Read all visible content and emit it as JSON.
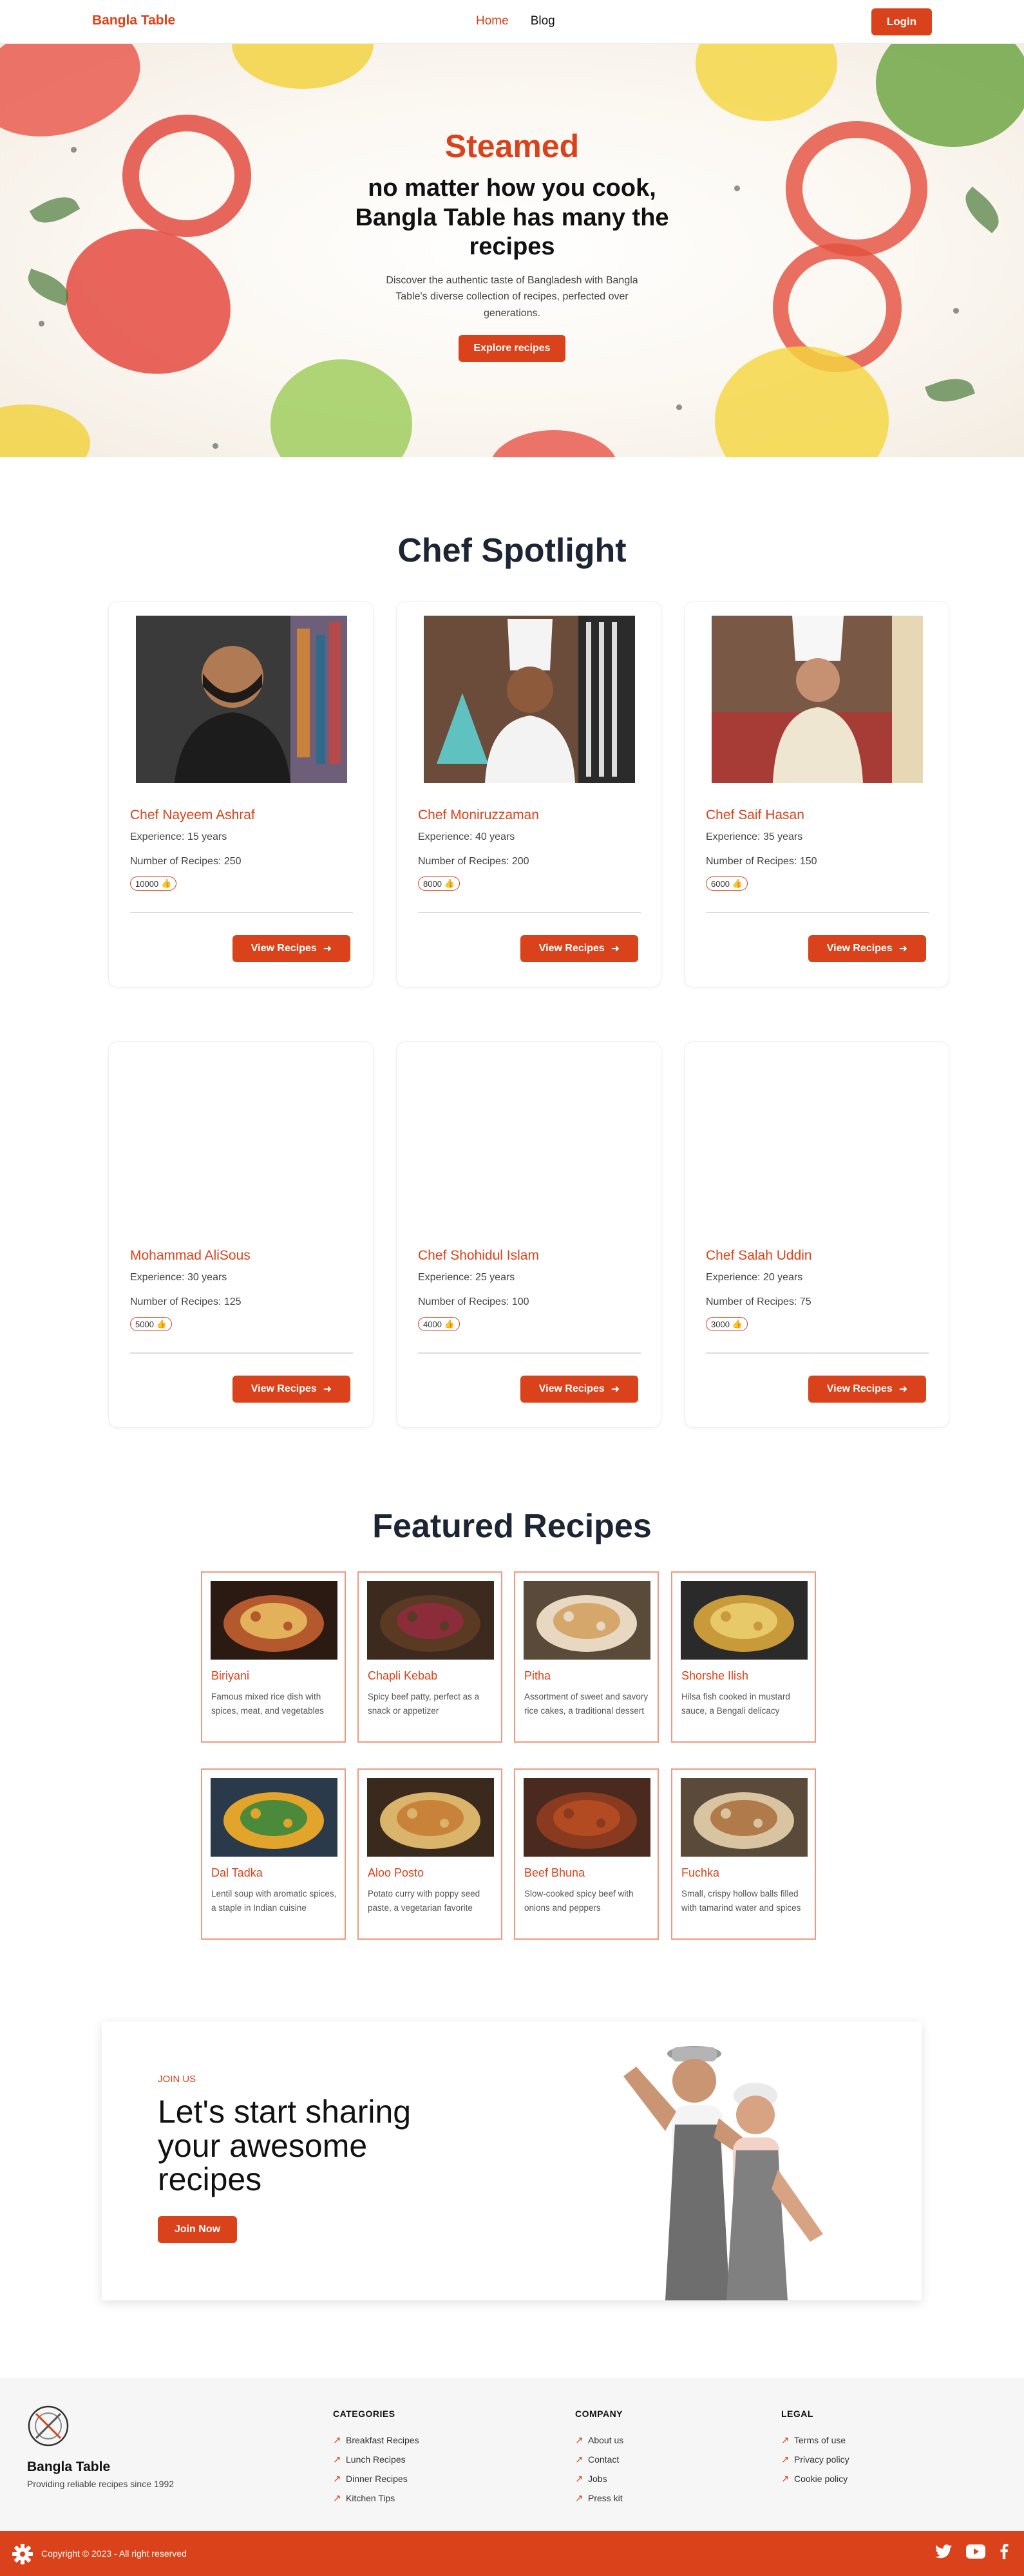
{
  "nav": {
    "brand": "Bangla Table",
    "links": [
      {
        "label": "Home"
      },
      {
        "label": "Blog"
      }
    ],
    "login": "Login"
  },
  "hero": {
    "tag": "Steamed",
    "title": "no matter how you cook, Bangla Table has many the recipes",
    "description": "Discover the authentic taste of Bangladesh with Bangla Table's diverse collection of recipes, perfected over generations.",
    "button": "Explore recipes"
  },
  "chefs": {
    "title": "Chef Spotlight",
    "view_label": "View Recipes",
    "items": [
      {
        "name": "Chef Nayeem Ashraf",
        "experience": "Experience: 15 years",
        "recipes": "Number of Recipes: 250",
        "likes": "10000"
      },
      {
        "name": "Chef Moniruzzaman",
        "experience": "Experience: 40 years",
        "recipes": "Number of Recipes: 200",
        "likes": "8000"
      },
      {
        "name": "Chef Saif Hasan",
        "experience": "Experience: 35 years",
        "recipes": "Number of Recipes: 150",
        "likes": "6000"
      },
      {
        "name": "Mohammad AliSous",
        "experience": "Experience: 30 years",
        "recipes": "Number of Recipes: 125",
        "likes": "5000"
      },
      {
        "name": "Chef Shohidul Islam",
        "experience": "Experience: 25 years",
        "recipes": "Number of Recipes: 100",
        "likes": "4000"
      },
      {
        "name": "Chef Salah Uddin",
        "experience": "Experience: 20 years",
        "recipes": "Number of Recipes: 75",
        "likes": "3000"
      }
    ]
  },
  "featured": {
    "title": "Featured Recipes",
    "items": [
      {
        "name": "Biriyani",
        "desc": "Famous mixed rice dish with spices, meat, and vegetables"
      },
      {
        "name": "Chapli Kebab",
        "desc": "Spicy beef patty, perfect as a snack or appetizer"
      },
      {
        "name": "Pitha",
        "desc": "Assortment of sweet and savory rice cakes, a traditional dessert"
      },
      {
        "name": "Shorshe Ilish",
        "desc": "Hilsa fish cooked in mustard sauce, a Bengali delicacy"
      },
      {
        "name": "Dal Tadka",
        "desc": "Lentil soup with aromatic spices, a staple in Indian cuisine"
      },
      {
        "name": "Aloo Posto",
        "desc": "Potato curry with poppy seed paste, a vegetarian favorite"
      },
      {
        "name": "Beef Bhuna",
        "desc": "Slow-cooked spicy beef with onions and peppers"
      },
      {
        "name": "Fuchka",
        "desc": "Small, crispy hollow balls filled with tamarind water and spices"
      }
    ]
  },
  "join": {
    "tag": "JOIN US",
    "title": "Let's start sharing your awesome recipes",
    "button": "Join Now"
  },
  "footer": {
    "brand": "Bangla Table",
    "tagline": "Providing reliable recipes since 1992",
    "columns": [
      {
        "title": "CATEGORIES",
        "links": [
          "Breakfast Recipes",
          "Lunch Recipes",
          "Dinner Recipes",
          "Kitchen Tips"
        ]
      },
      {
        "title": "COMPANY",
        "links": [
          "About us",
          "Contact",
          "Jobs",
          "Press kit"
        ]
      },
      {
        "title": "LEGAL",
        "links": [
          "Terms of use",
          "Privacy policy",
          "Cookie policy"
        ]
      }
    ],
    "copyright": "Copyright © 2023 - All right reserved",
    "socials": [
      "twitter-icon",
      "youtube-icon",
      "facebook-icon"
    ]
  },
  "colors": {
    "accent": "#d9421a",
    "heading": "#1d2433"
  }
}
